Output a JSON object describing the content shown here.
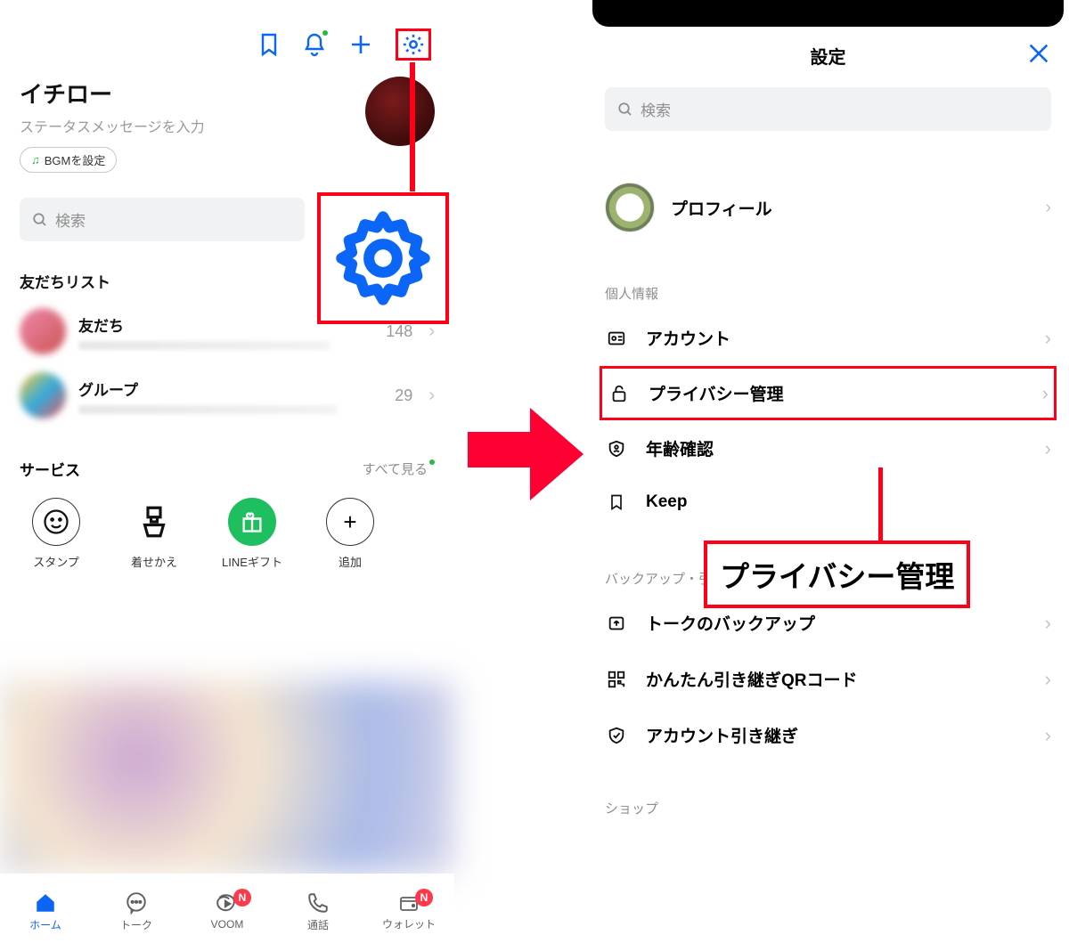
{
  "left": {
    "username": "イチロー",
    "status_placeholder": "ステータスメッセージを入力",
    "bgm_label": "BGMを設定",
    "search_placeholder": "検索",
    "friends_section": "友だちリスト",
    "friends_row": {
      "title": "友だち",
      "count": "148"
    },
    "groups_row": {
      "title": "グループ",
      "count": "29"
    },
    "services_section": "サービス",
    "services_viewall": "すべて見る",
    "services": {
      "stamp": "スタンプ",
      "theme": "着せかえ",
      "gift": "LINEギフト",
      "add": "追加"
    },
    "tabs": {
      "home": "ホーム",
      "talk": "トーク",
      "voom": "VOOM",
      "call": "通話",
      "wallet": "ウォレット",
      "badge": "N"
    }
  },
  "right": {
    "title": "設定",
    "search_placeholder": "検索",
    "profile_label": "プロフィール",
    "section_personal": "個人情報",
    "items": {
      "account": "アカウント",
      "privacy": "プライバシー管理",
      "age": "年齢確認",
      "keep": "Keep"
    },
    "section_backup": "バックアップ・引き継ぎ",
    "items2": {
      "talk_backup": "トークのバックアップ",
      "easy_qr": "かんたん引き継ぎQRコード",
      "account_transfer": "アカウント引き継ぎ"
    },
    "section_shop": "ショップ"
  },
  "callout": {
    "privacy": "プライバシー管理"
  }
}
